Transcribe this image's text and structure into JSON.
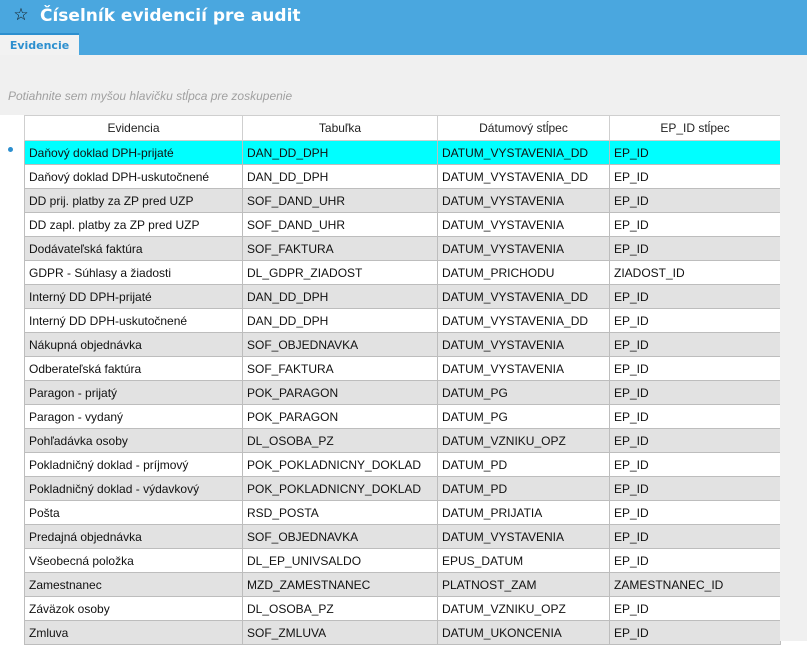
{
  "window": {
    "title": "Číselník evidencií pre audit",
    "title_icon": "star-icon"
  },
  "tabs": [
    {
      "label": "Evidencie",
      "active": true
    }
  ],
  "group_panel": {
    "hint": "Potiahnite sem myšou hlavičku stĺpca pre zoskupenie"
  },
  "grid": {
    "columns": [
      "Evidencia",
      "Tabuľka",
      "Dátumový stĺpec",
      "EP_ID stĺpec"
    ],
    "selected_row_index": 0,
    "rows": [
      [
        "Daňový doklad DPH-prijaté",
        "DAN_DD_DPH",
        "DATUM_VYSTAVENIA_DD",
        "EP_ID"
      ],
      [
        "Daňový doklad DPH-uskutočnené",
        "DAN_DD_DPH",
        "DATUM_VYSTAVENIA_DD",
        "EP_ID"
      ],
      [
        "DD prij. platby za ZP pred UZP",
        "SOF_DAND_UHR",
        "DATUM_VYSTAVENIA",
        "EP_ID"
      ],
      [
        "DD zapl. platby za ZP pred UZP",
        "SOF_DAND_UHR",
        "DATUM_VYSTAVENIA",
        "EP_ID"
      ],
      [
        "Dodávateľská faktúra",
        "SOF_FAKTURA",
        "DATUM_VYSTAVENIA",
        "EP_ID"
      ],
      [
        "GDPR - Súhlasy a žiadosti",
        "DL_GDPR_ZIADOST",
        "DATUM_PRICHODU",
        "ZIADOST_ID"
      ],
      [
        "Interný DD DPH-prijaté",
        "DAN_DD_DPH",
        "DATUM_VYSTAVENIA_DD",
        "EP_ID"
      ],
      [
        "Interný DD DPH-uskutočnené",
        "DAN_DD_DPH",
        "DATUM_VYSTAVENIA_DD",
        "EP_ID"
      ],
      [
        "Nákupná objednávka",
        "SOF_OBJEDNAVKA",
        "DATUM_VYSTAVENIA",
        "EP_ID"
      ],
      [
        "Odberateľská faktúra",
        "SOF_FAKTURA",
        "DATUM_VYSTAVENIA",
        "EP_ID"
      ],
      [
        "Paragon - prijatý",
        "POK_PARAGON",
        "DATUM_PG",
        "EP_ID"
      ],
      [
        "Paragon - vydaný",
        "POK_PARAGON",
        "DATUM_PG",
        "EP_ID"
      ],
      [
        "Pohľadávka osoby",
        "DL_OSOBA_PZ",
        "DATUM_VZNIKU_OPZ",
        "EP_ID"
      ],
      [
        "Pokladničný doklad - príjmový",
        "POK_POKLADNICNY_DOKLAD",
        "DATUM_PD",
        "EP_ID"
      ],
      [
        "Pokladničný doklad - výdavkový",
        "POK_POKLADNICNY_DOKLAD",
        "DATUM_PD",
        "EP_ID"
      ],
      [
        "Pošta",
        "RSD_POSTA",
        "DATUM_PRIJATIA",
        "EP_ID"
      ],
      [
        "Predajná objednávka",
        "SOF_OBJEDNAVKA",
        "DATUM_VYSTAVENIA",
        "EP_ID"
      ],
      [
        "Všeobecná položka",
        "DL_EP_UNIVSALDO",
        "EPUS_DATUM",
        "EP_ID"
      ],
      [
        "Zamestnanec",
        "MZD_ZAMESTNANEC",
        "PLATNOST_ZAM",
        "ZAMESTNANEC_ID"
      ],
      [
        "Záväzok osoby",
        "DL_OSOBA_PZ",
        "DATUM_VZNIKU_OPZ",
        "EP_ID"
      ],
      [
        "Zmluva",
        "SOF_ZMLUVA",
        "DATUM_UKONCENIA",
        "EP_ID"
      ]
    ]
  },
  "colors": {
    "titlebar": "#4aa7df",
    "selected_row": "#00ffff",
    "alternate_row": "#e2e2e2",
    "accent": "#2c8fcf"
  }
}
